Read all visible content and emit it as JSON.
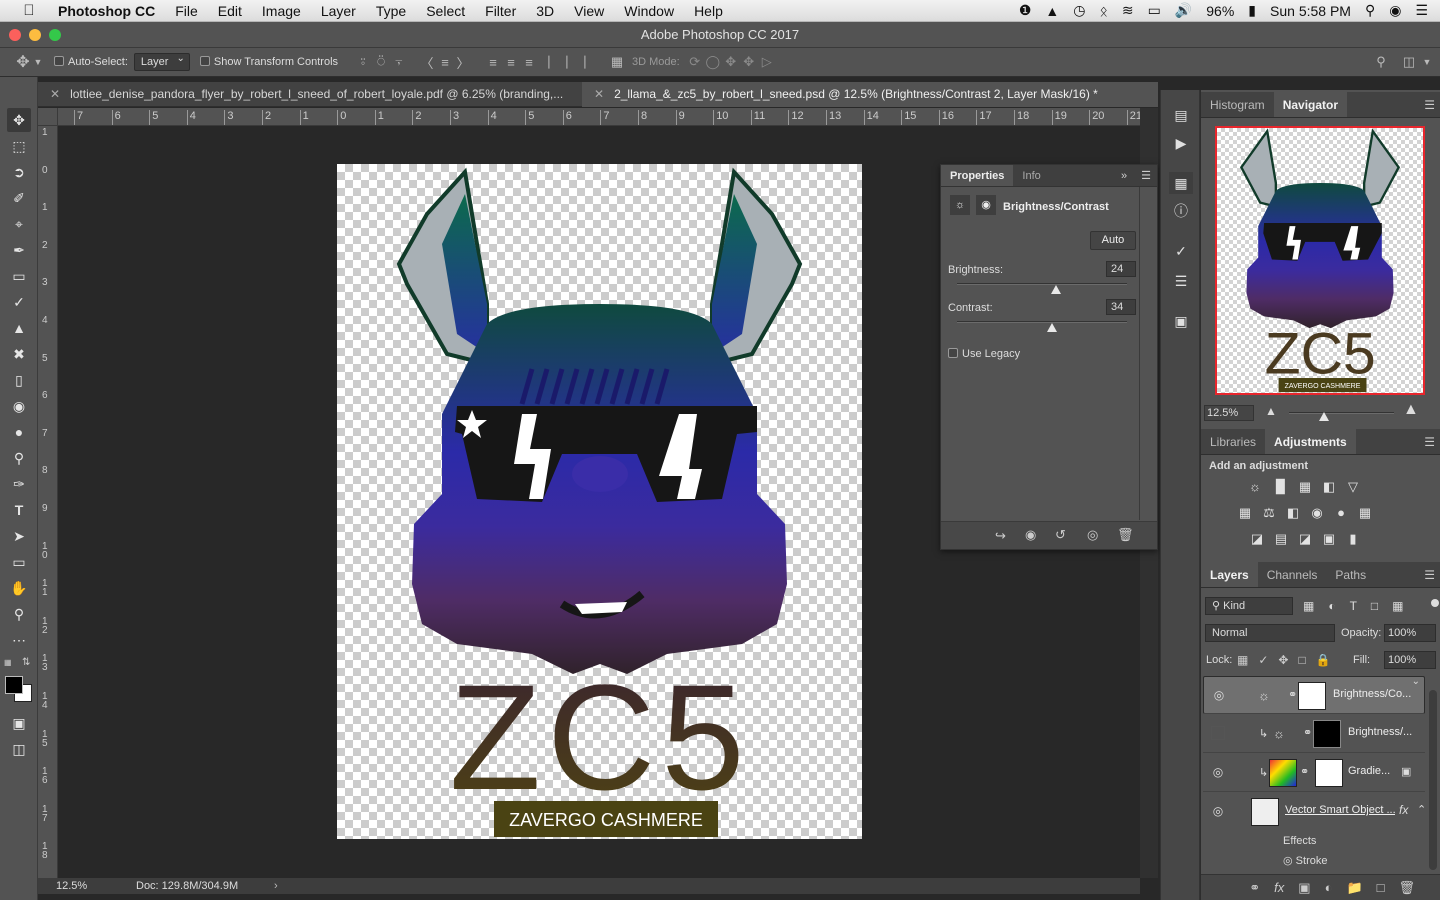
{
  "menubar": {
    "app": "Photoshop CC",
    "items": [
      "File",
      "Edit",
      "Image",
      "Layer",
      "Type",
      "Select",
      "Filter",
      "3D",
      "View",
      "Window",
      "Help"
    ],
    "battery": "96%",
    "clock": "Sun 5:58 PM"
  },
  "window": {
    "title": "Adobe Photoshop CC 2017"
  },
  "options": {
    "auto_select_label": "Auto-Select:",
    "auto_select_value": "Layer",
    "transform_label": "Show Transform Controls",
    "mode3d_label": "3D Mode:"
  },
  "tabs": [
    {
      "label": "lottiee_denise_pandora_flyer_by_robert_l_sneed_of_robert_loyale.pdf @ 6.25% (branding,..."
    },
    {
      "label": "2_llama_&_zc5_by_robert_l_sneed.psd @ 12.5% (Brightness/Contrast 2, Layer Mask/16) *"
    }
  ],
  "ruler_h": [
    "7",
    "6",
    "5",
    "4",
    "3",
    "2",
    "1",
    "0",
    "1",
    "2",
    "3",
    "4",
    "5",
    "6",
    "7",
    "8",
    "9",
    "10",
    "11",
    "12",
    "13",
    "14",
    "15",
    "16",
    "17",
    "18",
    "19",
    "20",
    "21"
  ],
  "ruler_v": [
    "1",
    "0",
    "1",
    "2",
    "3",
    "4",
    "5",
    "6",
    "7",
    "8",
    "9",
    "1 0",
    "1 1",
    "1 2",
    "1 3",
    "1 4",
    "1 5",
    "1 6",
    "1 7",
    "1 8"
  ],
  "artwork": {
    "logo_text": "ZC5",
    "banner_text": "ZAVERGO CASHMERE",
    "thumb_logo": "ZC5",
    "thumb_banner": "ZAVERGO CASHMERE"
  },
  "status": {
    "zoom": "12.5%",
    "doc": "Doc: 129.8M/304.9M"
  },
  "properties": {
    "tabs": [
      "Properties",
      "Info"
    ],
    "title": "Brightness/Contrast",
    "auto_button": "Auto",
    "brightness_label": "Brightness:",
    "brightness_value": "24",
    "brightness": 24,
    "contrast_label": "Contrast:",
    "contrast_value": "34",
    "contrast": 34,
    "legacy_label": "Use Legacy"
  },
  "navigator": {
    "tabs": [
      "Histogram",
      "Navigator"
    ],
    "zoom": "12.5%"
  },
  "adjustments": {
    "tabs": [
      "Libraries",
      "Adjustments"
    ],
    "heading": "Add an adjustment"
  },
  "layers": {
    "tabs": [
      "Layers",
      "Channels",
      "Paths"
    ],
    "filter": "Kind",
    "blend_mode": "Normal",
    "opacity_label": "Opacity:",
    "opacity": "100%",
    "lock_label": "Lock:",
    "fill_label": "Fill:",
    "fill": "100%",
    "rows": [
      {
        "name": "Brightness/Co...",
        "visible": true,
        "selected": true
      },
      {
        "name": "Brightness/...",
        "visible": false,
        "selected": false
      },
      {
        "name": "Gradie...",
        "visible": true,
        "selected": false
      },
      {
        "name": "Vector Smart Object ...",
        "visible": true,
        "selected": false
      }
    ],
    "effects_label": "Effects",
    "stroke_label": "Stroke"
  },
  "colors": {
    "accent_red": "#e8262d",
    "panel": "#535353",
    "canvas_bg": "#282828"
  }
}
